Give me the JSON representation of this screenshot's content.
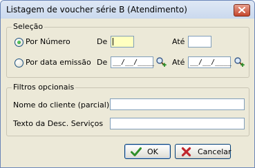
{
  "window": {
    "title": "Listagem de voucher série B (Atendimento)"
  },
  "selection": {
    "group_title": "Seleção",
    "by_number": {
      "label": "Por Número",
      "selected": true,
      "from_label": "De",
      "from_value": "",
      "to_label": "Até",
      "to_value": ""
    },
    "by_date": {
      "label": "Por data emissão",
      "selected": false,
      "from_label": "De",
      "from_value": "__/__/____",
      "to_label": "Até",
      "to_value": "__/__/____"
    }
  },
  "filters": {
    "group_title": "Filtros opcionais",
    "client_name_label": "Nome do cliente (parcial)",
    "client_name_value": "",
    "service_desc_label": "Texto da Desc. Serviços",
    "service_desc_value": ""
  },
  "buttons": {
    "ok_label": "OK",
    "cancel_label": "Cancelar"
  },
  "colors": {
    "dialog_background": "#ece9d8",
    "focused_field": "#ffffc0",
    "ok_check": "#2f8f2a",
    "cancel_x": "#c0262c"
  }
}
